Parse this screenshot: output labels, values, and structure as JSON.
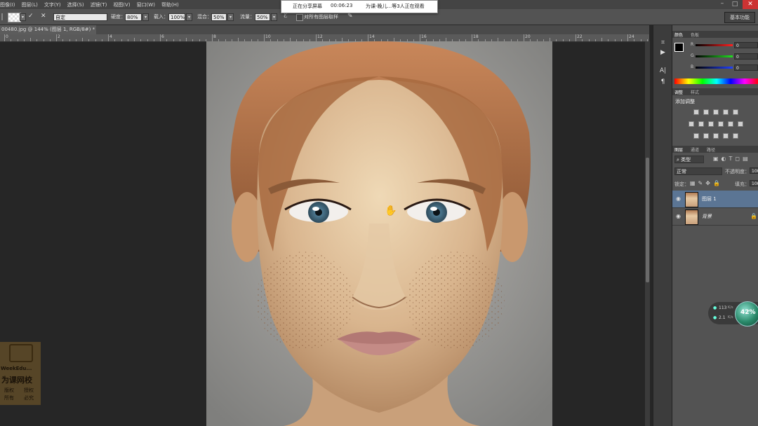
{
  "menu": [
    "图像(I)",
    "图层(L)",
    "文字(Y)",
    "选择(S)",
    "滤镜(T)",
    "视图(V)",
    "窗口(W)",
    "帮助(H)"
  ],
  "options": {
    "mode_value": "自定",
    "opacity_label": "硬度：",
    "opacity_value": "80%",
    "strength_label": "载入：",
    "strength_value": "100%",
    "mix_label": "混合：",
    "mix_value": "50%",
    "flow_label": "流量：",
    "flow_value": "50%",
    "sample_all_label": "对所有图层取样"
  },
  "workspace": "基本功能",
  "share": {
    "status": "正在分享屏幕",
    "time": "00:06:23",
    "viewers": "为课-晚儿...等3人正在观看"
  },
  "doc_tab": "00480.jpg @ 144% (图层 1, RGB/8#) *",
  "ruler_labels": [
    "0",
    "2",
    "4",
    "6",
    "8",
    "10",
    "12",
    "14",
    "16",
    "18",
    "20",
    "22",
    "24"
  ],
  "panels": {
    "color_tabs": [
      "颜色",
      "色板"
    ],
    "channels": [
      {
        "label": "R",
        "value": "0",
        "color": "#e02020"
      },
      {
        "label": "G",
        "value": "0",
        "color": "#20c020"
      },
      {
        "label": "B",
        "value": "0",
        "color": "#2040e0"
      }
    ],
    "adjust_tabs": [
      "调整",
      "样式"
    ],
    "adjust_title": "添加调整",
    "layer_tabs": [
      "图层",
      "通道",
      "路径"
    ],
    "layer_filter": "类型",
    "blend_mode": "正常",
    "opacity_label": "不透明度：",
    "opacity_value": "100",
    "lock_label": "锁定：",
    "fill_label": "填充：",
    "fill_value": "100",
    "layers": [
      "图层 1",
      "背景"
    ]
  },
  "net": {
    "up": "113",
    "up_unit": "K/s",
    "down": "2.1",
    "down_unit": "K/s",
    "cpu": "42%"
  },
  "watermark": {
    "brand": "WeekEdu...",
    "name": "为课网校",
    "line1a": "版权",
    "line1b": "授权",
    "line2a": "所有",
    "line2b": "必究"
  }
}
